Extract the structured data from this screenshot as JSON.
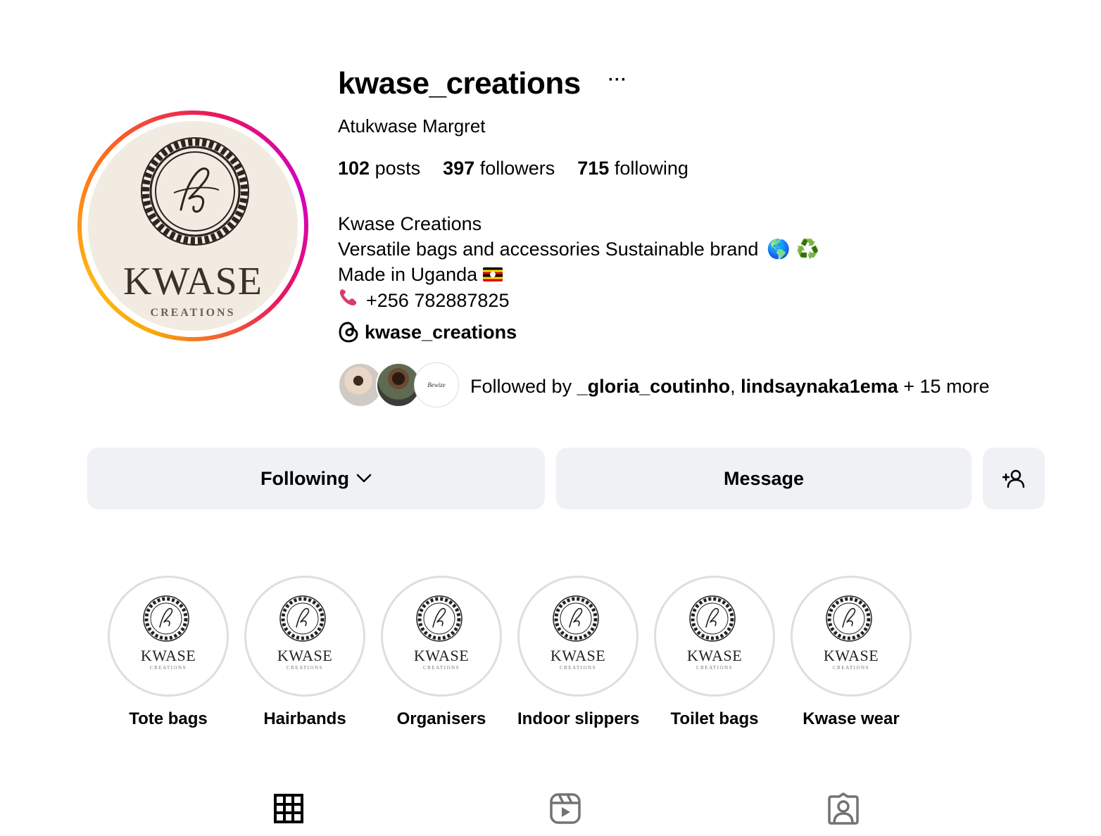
{
  "profile": {
    "username": "kwase_creations",
    "more_label": "···",
    "full_name": "Atukwase Margret",
    "avatar_logo_word": "KWASE",
    "avatar_logo_sub": "CREATIONS"
  },
  "stats": {
    "posts_count": "102",
    "posts_label": "posts",
    "followers_count": "397",
    "followers_label": "followers",
    "following_count": "715",
    "following_label": "following"
  },
  "bio": {
    "line1": "Kwase Creations",
    "line2": "Versatile bags and accessories Sustainable brand",
    "line2_emojis": "🌎 ♻️",
    "line3": "Made in Uganda",
    "line4_phone": "+256 782887825"
  },
  "threads": {
    "handle": "kwase_creations",
    "icon": "threads-icon"
  },
  "followed_by": {
    "prefix": "Followed by ",
    "user1": "_gloria_coutinho",
    "separator": ", ",
    "user2": "lindsaynaka1ema",
    "suffix": " + 15 more",
    "avatar3_text": "Bewize"
  },
  "buttons": {
    "following_label": "Following",
    "message_label": "Message",
    "suggest_icon": "add-person-icon"
  },
  "highlights": [
    {
      "label": "Tote bags"
    },
    {
      "label": "Hairbands"
    },
    {
      "label": "Organisers"
    },
    {
      "label": "Indoor slippers"
    },
    {
      "label": "Toilet bags"
    },
    {
      "label": "Kwase wear"
    }
  ],
  "highlight_logo": {
    "word": "KWASE",
    "sub": "CREATIONS"
  },
  "tabs": [
    {
      "name": "posts",
      "icon": "grid-icon"
    },
    {
      "name": "reels",
      "icon": "reels-icon"
    },
    {
      "name": "tagged",
      "icon": "tagged-icon"
    }
  ],
  "colors": {
    "button_bg": "#eff1f5",
    "highlight_ring": "#dbdfe4",
    "story_ring_start": "#f9a707",
    "story_ring_end": "#d300c5"
  }
}
